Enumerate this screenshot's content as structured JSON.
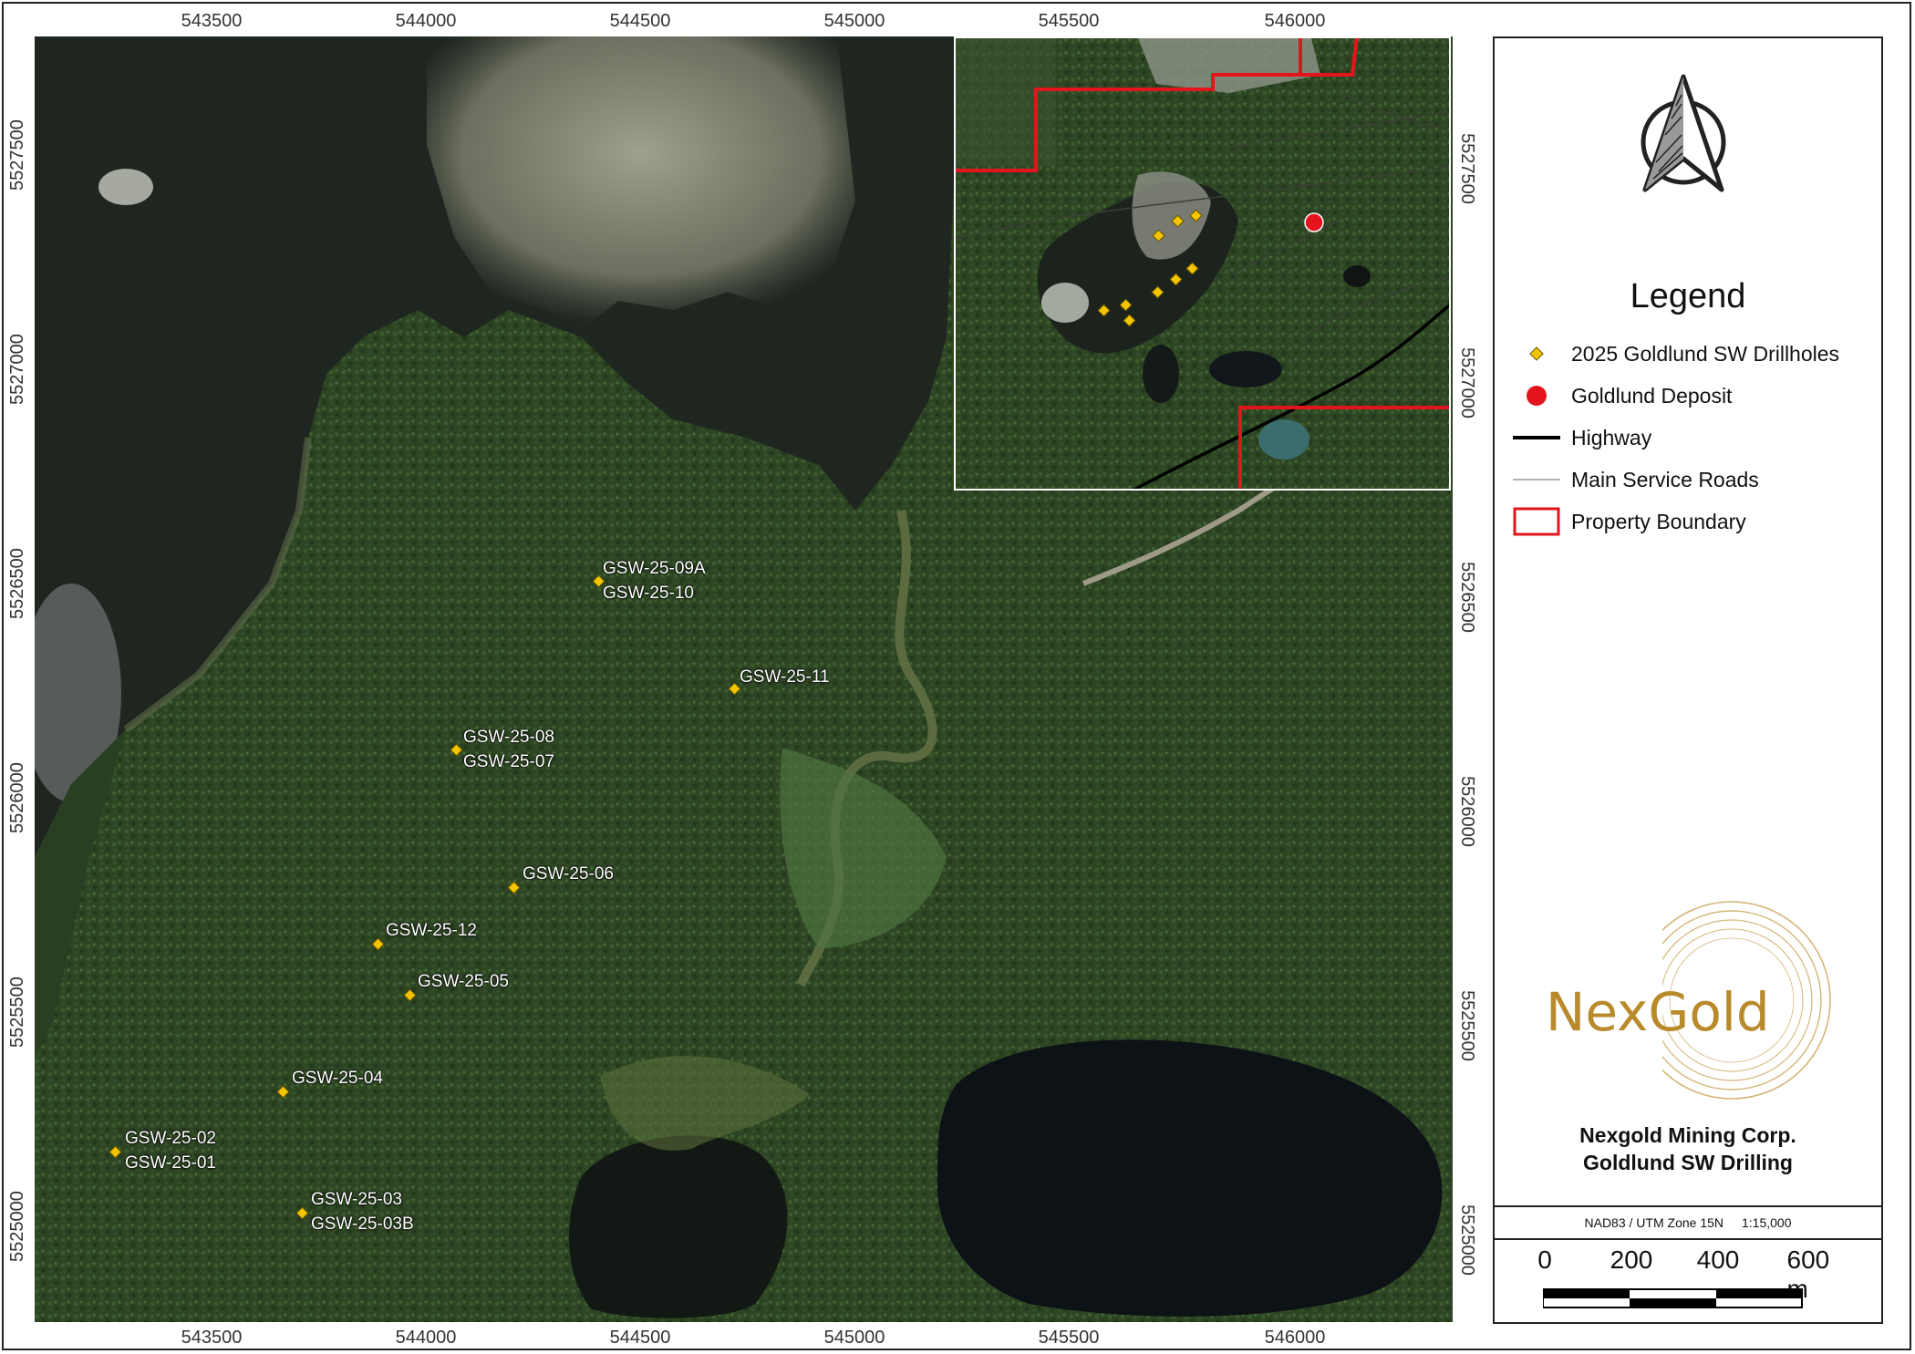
{
  "coordinate_ticks": {
    "easting_top": [
      "543500",
      "544000",
      "544500",
      "545000",
      "545500",
      "546000"
    ],
    "easting_bottom": [
      "543500",
      "544000",
      "544500",
      "545000",
      "545500",
      "546000"
    ],
    "northing_left": [
      "5527500",
      "5527000",
      "5526500",
      "5526000",
      "5525500",
      "5525000"
    ],
    "northing_right": [
      "5527500",
      "5527000",
      "5526500",
      "5526000",
      "5525500",
      "5525000"
    ]
  },
  "drillholes": [
    {
      "id": "dh09",
      "labels": [
        "GSW-25-09A",
        "GSW-25-10"
      ]
    },
    {
      "id": "dh11",
      "labels": [
        "GSW-25-11"
      ]
    },
    {
      "id": "dh08",
      "labels": [
        "GSW-25-08",
        "GSW-25-07"
      ]
    },
    {
      "id": "dh06",
      "labels": [
        "GSW-25-06"
      ]
    },
    {
      "id": "dh12",
      "labels": [
        "GSW-25-12"
      ]
    },
    {
      "id": "dh05",
      "labels": [
        "GSW-25-05"
      ]
    },
    {
      "id": "dh04",
      "labels": [
        "GSW-25-04"
      ]
    },
    {
      "id": "dh02",
      "labels": [
        "GSW-25-02",
        "GSW-25-01"
      ]
    },
    {
      "id": "dh03",
      "labels": [
        "GSW-25-03",
        "GSW-25-03B"
      ]
    }
  ],
  "legend": {
    "title": "Legend",
    "items": [
      {
        "label": "2025 Goldlund SW Drillholes",
        "symbol": "yellow-diamond",
        "color": "#f2c500"
      },
      {
        "label": "Goldlund Deposit",
        "symbol": "red-circle",
        "color": "#e3141b"
      },
      {
        "label": "Highway",
        "symbol": "thick-black-line",
        "color": "#000000"
      },
      {
        "label": "Main Service Roads",
        "symbol": "thin-grey-line",
        "color": "#999999"
      },
      {
        "label": "Property Boundary",
        "symbol": "red-outline-box",
        "color": "#e3141b"
      }
    ]
  },
  "logo": {
    "text": "NexGold",
    "color": "#b98a2c"
  },
  "title_block": {
    "company": "Nexgold Mining Corp.",
    "project": "Goldlund SW Drilling",
    "projection": "NAD83 / UTM Zone 15N",
    "scale": "1:15,000"
  },
  "scale_bar": {
    "labels": [
      "0",
      "200",
      "400",
      "600 m"
    ]
  }
}
